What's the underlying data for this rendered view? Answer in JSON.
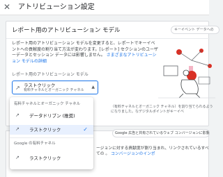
{
  "header": {
    "title": "アトリビューション設定"
  },
  "card": {
    "title": "レポート用のアトリビューション モデル",
    "chip": "キーイベント データへの",
    "description": "レポート用のアトリビューション モデルを変更すると、レポートでキーイベントへの貢献度の割り当て方法が変わります。[レポート] セクションのユーザーデータとセッション データには影響しません。",
    "description_link": "さまざまなアトリビューション モデルの詳細",
    "model_label": "レポート用のアトリビューション モデル",
    "select": {
      "value": "ラストクリック",
      "sub": "有料チャネルとオーガニック チャネル"
    },
    "behind_text": "（有料チャネルとオーガニック チャネル）を割り当てられるようになりました。なデジタルポイントがキーイベ"
  },
  "lower": {
    "chip": "Google 広告と共有されているウェブ コンバージョンに影響しま",
    "text": "ージョンに対する貢献度が割り当まれ、リンクされているすべての 。",
    "text_link": "コンバージョンのインポ"
  },
  "menu": {
    "groups": [
      {
        "label": "有料チャネルとオーガニック チャネル",
        "items": [
          {
            "label": "データドリブン (推奨)",
            "selected": false
          },
          {
            "label": "ラストクリック",
            "selected": true
          }
        ]
      },
      {
        "label": "Google の有料チャネル",
        "items": [
          {
            "label": "ラストクリック",
            "selected": false
          }
        ]
      }
    ]
  },
  "colors": {
    "accent": "#1a73e8",
    "selected_bg": "#e8f0fe",
    "illustration_red": "#d93025",
    "illustration_pink": "#f4b4c4"
  },
  "icons": {
    "close": "close-icon",
    "select_model": "path-icon",
    "caret": "caret-up-icon",
    "check": "check-icon"
  }
}
